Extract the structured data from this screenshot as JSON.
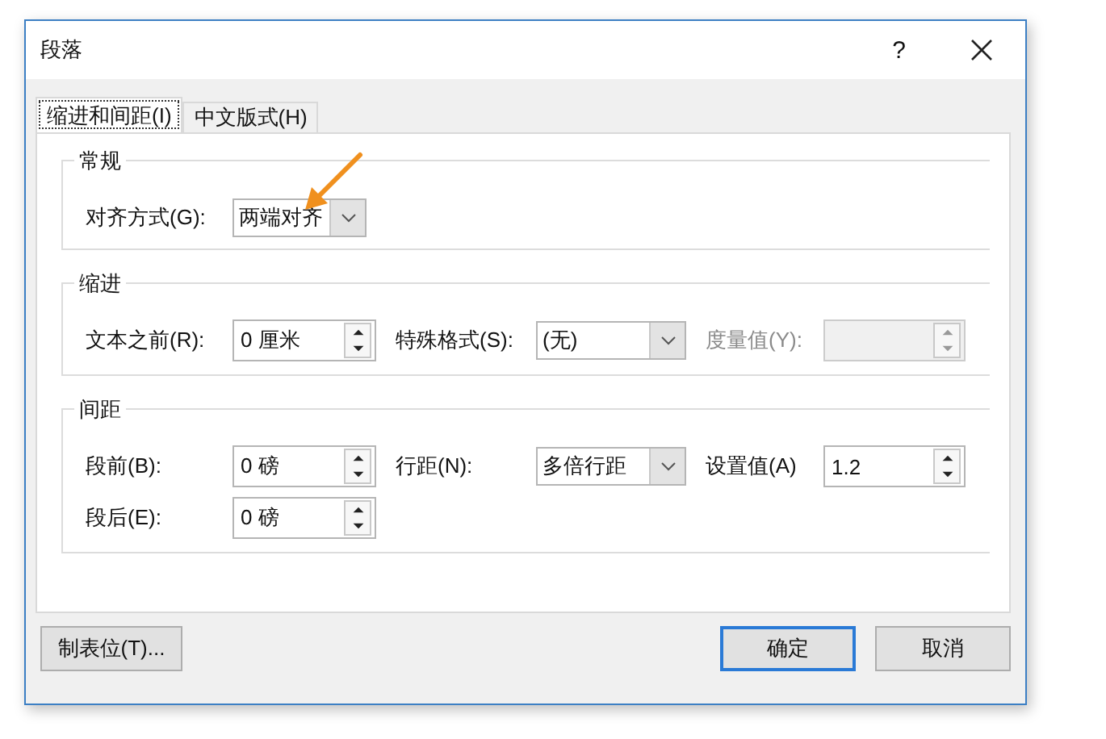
{
  "window": {
    "title": "段落",
    "help": "?"
  },
  "tabs": [
    {
      "label": "缩进和间距(I)",
      "selected": true
    },
    {
      "label": "中文版式(H)",
      "selected": false
    }
  ],
  "groups": [
    {
      "title": "常规",
      "rows": [
        [
          {
            "label": "对齐方式(G):",
            "kind": "dropdown",
            "value": "两端对齐",
            "disabled": false
          }
        ]
      ]
    },
    {
      "title": "缩进",
      "rows": [
        [
          {
            "label": "文本之前(R):",
            "kind": "spin",
            "value": "0 厘米",
            "disabled": false
          },
          {
            "label": "特殊格式(S):",
            "kind": "dropdown",
            "value": "(无)",
            "disabled": false
          },
          {
            "label": "度量值(Y):",
            "kind": "spin",
            "disabled": true
          }
        ]
      ]
    },
    {
      "title": "间距",
      "rows": [
        [
          {
            "label": "段前(B):",
            "kind": "spin",
            "value": "0 磅",
            "disabled": false
          },
          {
            "label": "行距(N):",
            "kind": "dropdown",
            "value": "多倍行距",
            "disabled": false
          },
          {
            "label": "设置值(A)",
            "kind": "spin",
            "value": "1.2",
            "disabled": false
          }
        ],
        [
          {
            "label": "段后(E):",
            "kind": "spin",
            "value": "0 磅",
            "disabled": false
          }
        ]
      ]
    }
  ],
  "footer": {
    "left": "制表位(T)...",
    "ok": "确定",
    "cancel": "取消"
  }
}
